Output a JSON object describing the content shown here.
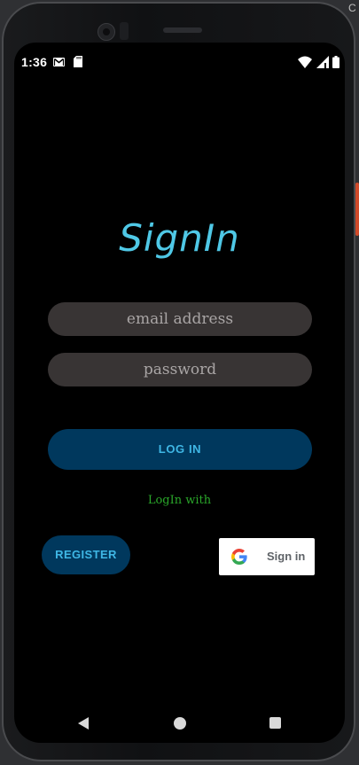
{
  "status_bar": {
    "time": "1:36",
    "icons": [
      "gmail-icon",
      "sd-card-icon",
      "wifi-icon",
      "signal-icon",
      "battery-icon"
    ]
  },
  "edge_text": "C",
  "signin": {
    "title": "SignIn",
    "email_placeholder": "email address",
    "email_value": "",
    "password_placeholder": "password",
    "password_value": "",
    "login_label": "LOG IN",
    "login_with_label": "LogIn with",
    "register_label": "REGISTER",
    "google_label": "Sign in"
  },
  "colors": {
    "title": "#4fc8e6",
    "button_bg": "#00385d",
    "button_text": "#3fb7e5",
    "field_bg": "#383434",
    "login_with_text": "#2aa72a",
    "screen_bg": "#000000"
  },
  "nav_bar": {
    "icons": [
      "back-icon",
      "home-icon",
      "recents-icon"
    ]
  }
}
